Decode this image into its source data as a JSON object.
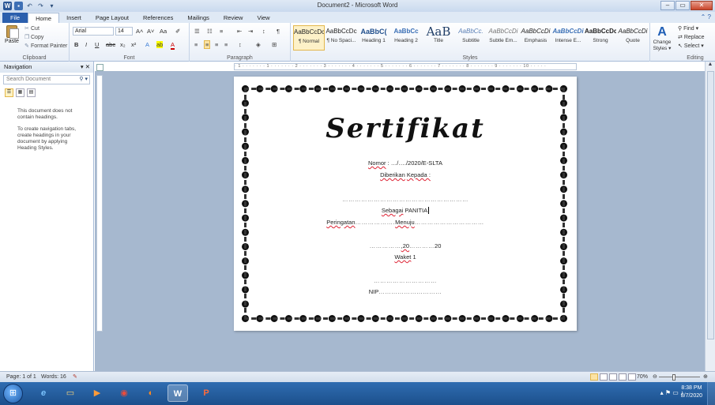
{
  "window": {
    "title": "Document2 - Microsoft Word"
  },
  "quick_access": {
    "word": "W",
    "save": "▪",
    "undo": "↶",
    "redo": "↷",
    "more": "▾"
  },
  "window_controls": {
    "minimize": "‒",
    "maximize": "▭",
    "close": "✕"
  },
  "tabs": [
    "File",
    "Home",
    "Insert",
    "Page Layout",
    "References",
    "Mailings",
    "Review",
    "View"
  ],
  "active_tab": "Home",
  "ribbon": {
    "clipboard": {
      "label": "Clipboard",
      "paste": "Paste",
      "cut": "Cut",
      "copy": "Copy",
      "format_painter": "Format Painter"
    },
    "font": {
      "label": "Font",
      "name": "Arial",
      "size": "14",
      "grow": "A˄",
      "shrink": "A˅",
      "case": "Aa",
      "clear": "✐",
      "bold": "B",
      "italic": "I",
      "underline": "U",
      "strike": "abc",
      "sub": "x₂",
      "sup": "x²",
      "effects": "A",
      "highlight": "ab",
      "color": "A"
    },
    "paragraph": {
      "label": "Paragraph",
      "bullets": "☰",
      "numbering": "☷",
      "multilevel": "≡",
      "dec_indent": "⇤",
      "inc_indent": "⇥",
      "sort": "↕",
      "pilcrow": "¶",
      "align_left": "≡",
      "center": "≡",
      "align_right": "≡",
      "justify": "≡",
      "line_spacing": "↕",
      "shading": "◈",
      "borders": "⊞"
    },
    "styles": {
      "label": "Styles",
      "items": [
        {
          "preview": "AaBbCcDc",
          "name": "¶ Normal"
        },
        {
          "preview": "AaBbCcDc",
          "name": "¶ No Spaci..."
        },
        {
          "preview": "AaBbC(",
          "name": "Heading 1"
        },
        {
          "preview": "AaBbCc",
          "name": "Heading 2"
        },
        {
          "preview": "AaB",
          "name": "Title"
        },
        {
          "preview": "AaBbCc.",
          "name": "Subtitle"
        },
        {
          "preview": "AaBbCcDi",
          "name": "Subtle Em..."
        },
        {
          "preview": "AaBbCcDi",
          "name": "Emphasis"
        },
        {
          "preview": "AaBbCcDi",
          "name": "Intense E..."
        },
        {
          "preview": "AaBbCcDc",
          "name": "Strong"
        },
        {
          "preview": "AaBbCcDi",
          "name": "Quote"
        }
      ],
      "change_styles": "Change Styles ▾"
    },
    "editing": {
      "label": "Editing",
      "find": "Find ▾",
      "replace": "Replace",
      "select": "Select ▾"
    }
  },
  "navigation": {
    "title": "Navigation",
    "close": "▾ ✕",
    "search_placeholder": "Search Document",
    "msg1": "This document does not contain headings.",
    "msg2": "To create navigation tabs, create headings in your document by applying Heading Styles."
  },
  "ruler_text": "· 1 · · · · · · · 1 · · · · · · · 2 · · · · · · · 3 · · · · · · · 4 · · · · · · · 5 · · · · · · · 6 · · · · · · · 7 · · · · · · · 8 · · · · · · · 9 · · · · · · · 10 · · · · ·",
  "certificate": {
    "title": "Sertifikat",
    "nomor_label": "Nomor",
    "nomor_rest": ": …/…./2020/E-SLTA",
    "diberikan": "Diberikan",
    "kepada": "Kepada :",
    "name_line": "……………………………………………………",
    "sebagai": "Sebagai",
    "panitia": "PANITIA",
    "peringatan": "Peringatan",
    "pdots1": "……………….",
    "menuju": "Menuju",
    "pdots2": "……………………………",
    "date_pre": "……………",
    "date_20": ",20",
    "date_mid": "…………",
    "date_post": "20",
    "waket": "Waket",
    "waket_num": "1",
    "sig_line": "…………………………",
    "nip": "NIP",
    "nip_dots": "…………………………"
  },
  "status": {
    "page": "Page: 1 of 1",
    "words": "Words: 16",
    "zoom": "70%",
    "zoom_minus": "⊖",
    "zoom_plus": "⊕"
  },
  "taskbar": {
    "start": "⊞",
    "apps": [
      {
        "name": "ie",
        "glyph": "e"
      },
      {
        "name": "explorer",
        "glyph": "▭"
      },
      {
        "name": "media",
        "glyph": "▶"
      },
      {
        "name": "chrome",
        "glyph": "◉"
      },
      {
        "name": "firefox",
        "glyph": "◐"
      },
      {
        "name": "word",
        "glyph": "W"
      },
      {
        "name": "powerpoint",
        "glyph": "P"
      }
    ],
    "tray": "▴  ⚑  ▭  ♪",
    "time": "8:38 PM",
    "date": "8/7/2020"
  }
}
